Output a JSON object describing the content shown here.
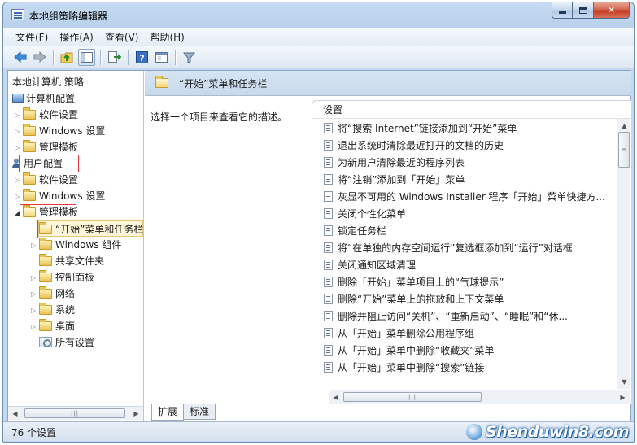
{
  "window": {
    "title": "本地组策略编辑器"
  },
  "menu": [
    "文件(F)",
    "操作(A)",
    "查看(V)",
    "帮助(H)"
  ],
  "toolbar": [
    "back-arrow-icon",
    "forward-arrow-icon",
    "folder-up-icon",
    "show-hide-tree-icon",
    "export-list-icon",
    "help-icon",
    "properties-icon",
    "filter-icon"
  ],
  "tree": {
    "root": "本地计算机 策略",
    "computer": "计算机配置",
    "c_software": "软件设置",
    "c_windows": "Windows 设置",
    "c_admin": "管理模板",
    "user": "用户配置",
    "u_software": "软件设置",
    "u_windows": "Windows 设置",
    "u_admin": "管理模板",
    "start": "“开始”菜单和任务栏",
    "win_components": "Windows 组件",
    "shared": "共享文件夹",
    "control": "控制面板",
    "network": "网络",
    "system": "系统",
    "desktop": "桌面",
    "all": "所有设置"
  },
  "panel": {
    "title": "“开始”菜单和任务栏",
    "description": "选择一个项目来查看它的描述。",
    "column": "设置",
    "items": [
      "将“搜索 Internet”链接添加到“开始”菜单",
      "退出系统时清除最近打开的文档的历史",
      "为新用户清除最近的程序列表",
      "将“注销”添加到「开始」菜单",
      "灰显不可用的 Windows Installer 程序「开始」菜单快捷方...",
      "关闭个性化菜单",
      "锁定任务栏",
      "将“在单独的内存空间运行”复选框添加到“运行”对话框",
      "关闭通知区域清理",
      "删除「开始」菜单项目上的“气球提示”",
      "删除“开始”菜单上的拖放和上下文菜单",
      "删除并阻止访问“关机”、“重新启动”、“睡眠”和“休...",
      "从「开始」菜单删除公用程序组",
      "从「开始」菜单中删除“收藏夹”菜单",
      "从「开始」菜单中删除“搜索”链接"
    ]
  },
  "tabs": [
    "扩展",
    "标准"
  ],
  "status": {
    "text": "76 个设置"
  },
  "watermark": {
    "text": "Shenduwin8.com"
  },
  "colors": {
    "highlight_box": "#e8363a",
    "header_bg": "#cfdff0",
    "selected_bg": "#fff6d9"
  }
}
